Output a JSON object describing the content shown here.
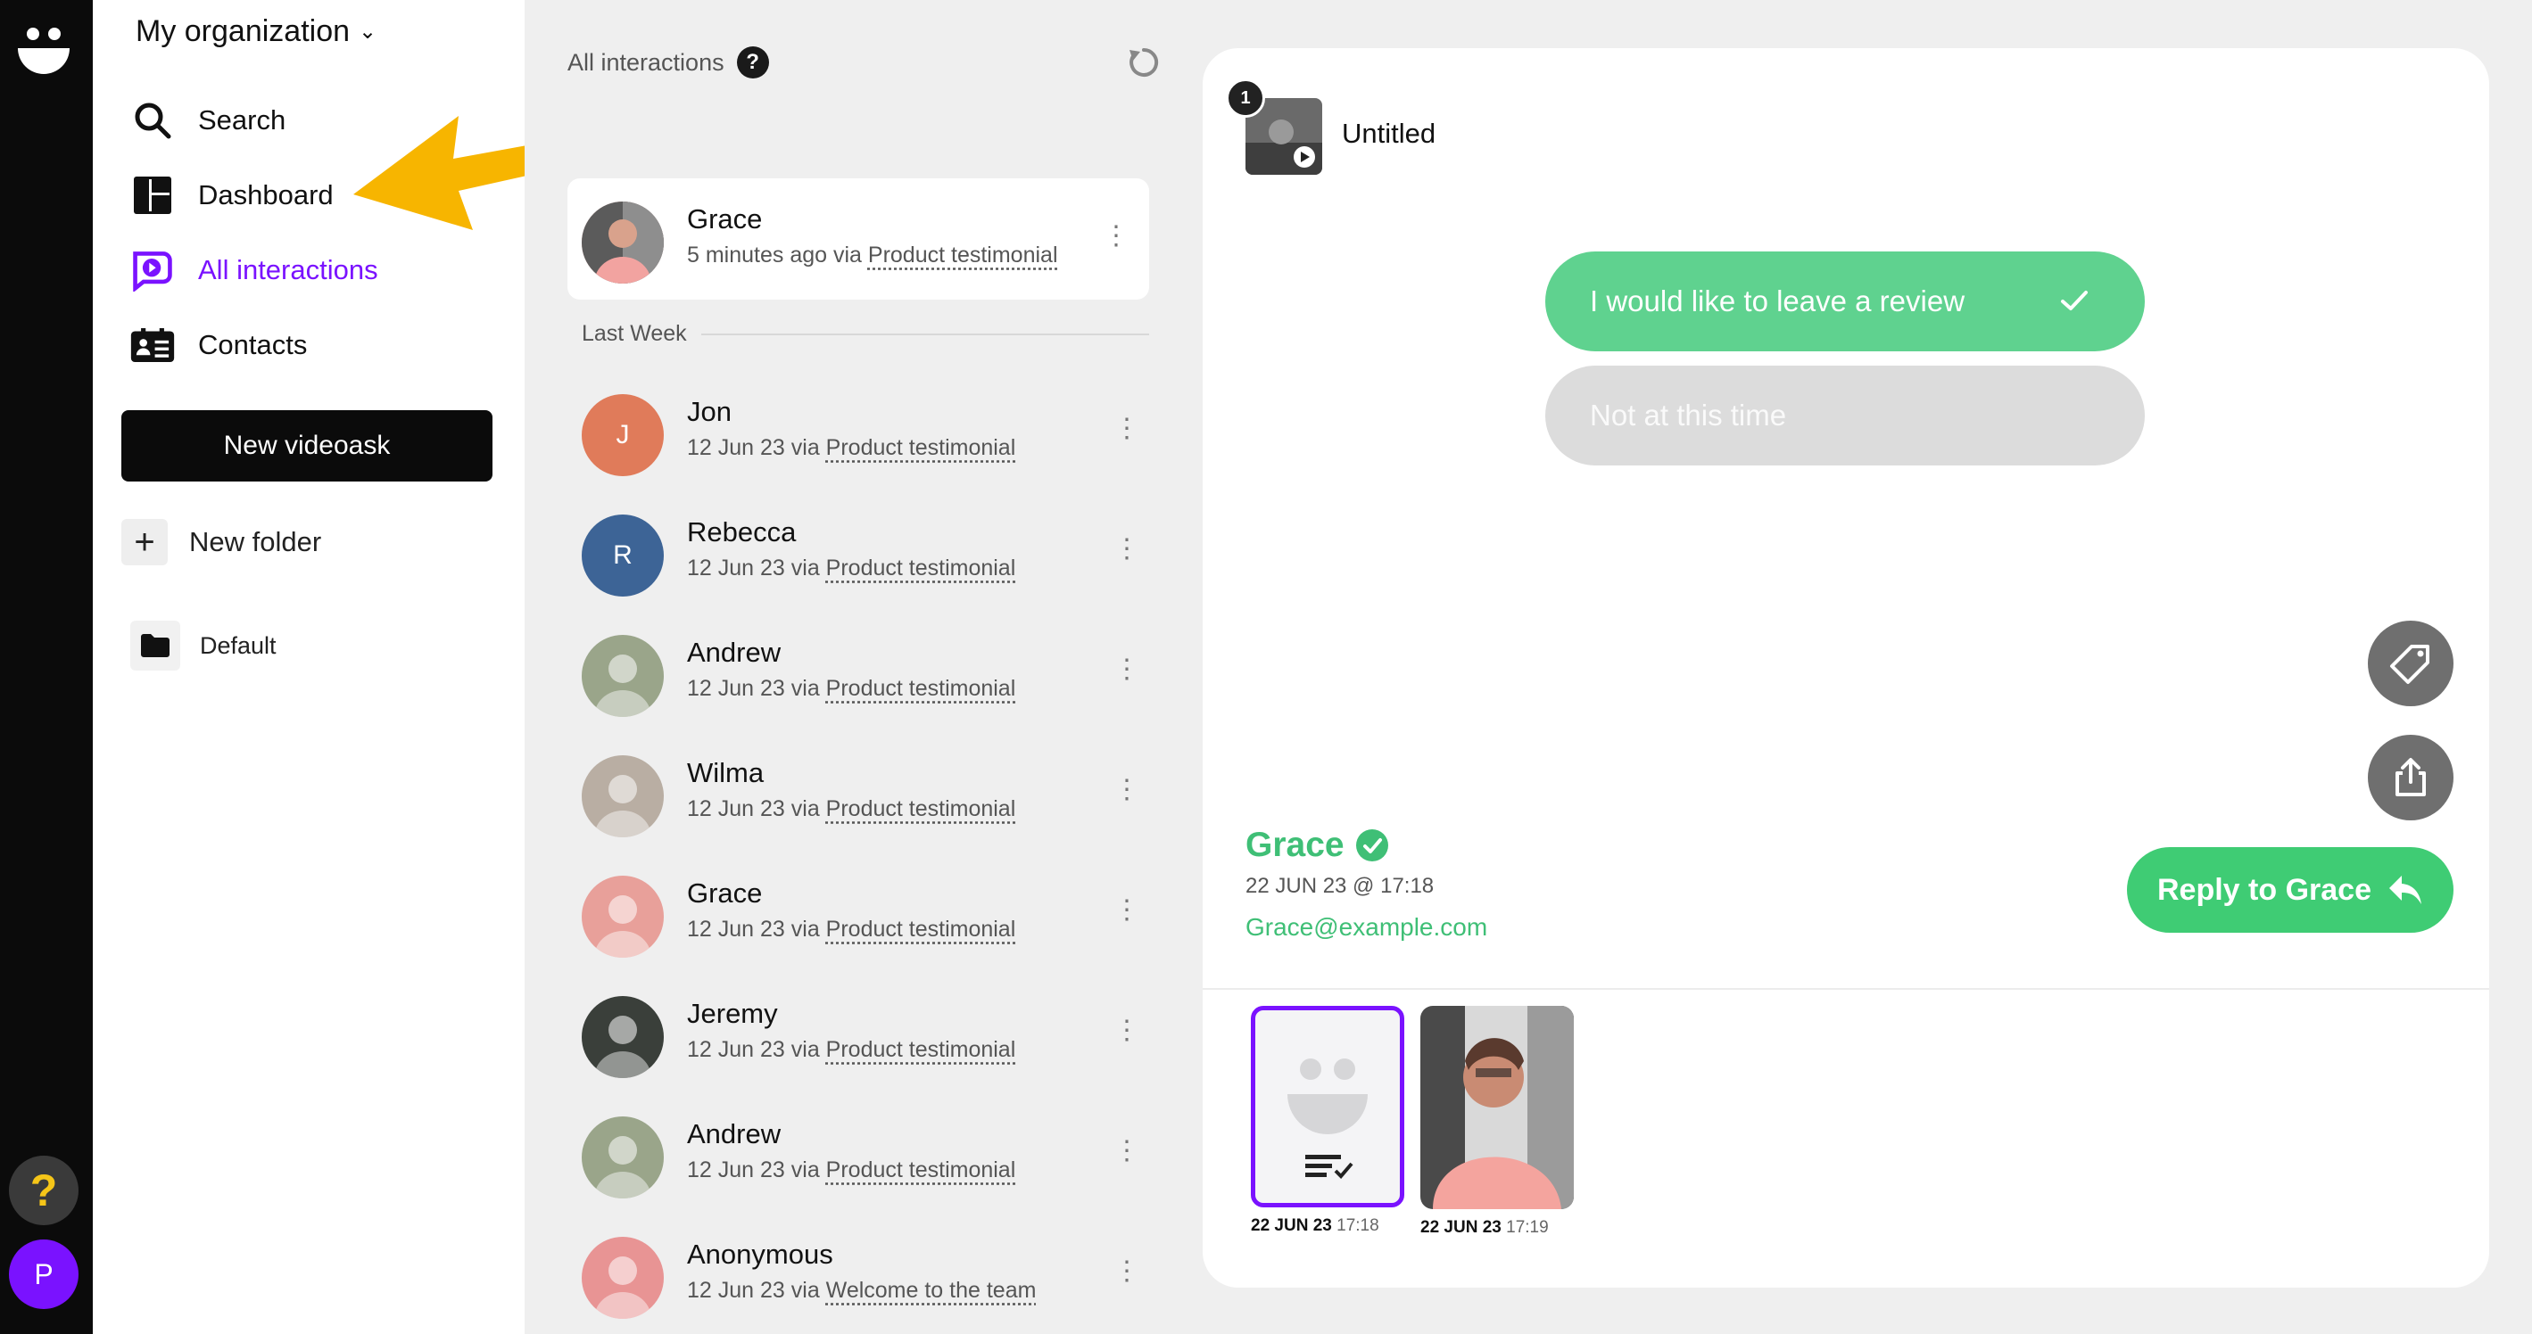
{
  "org": {
    "name": "My organization"
  },
  "nav": {
    "search": "Search",
    "dashboard": "Dashboard",
    "all_interactions": "All interactions",
    "contacts": "Contacts",
    "new_videoask": "New videoask",
    "new_folder": "New folder",
    "default_folder": "Default"
  },
  "rail": {
    "help": "?",
    "avatar": "P"
  },
  "list": {
    "header": "All interactions",
    "help": "?",
    "today": {
      "name": "Grace",
      "time": "5 minutes ago via",
      "source": "Product testimonial"
    },
    "section": "Last Week",
    "items": [
      {
        "name": "Jon",
        "date": "12 Jun 23 via",
        "source": "Product testimonial",
        "initial": "J",
        "color": "#e07b5a"
      },
      {
        "name": "Rebecca",
        "date": "12 Jun 23 via",
        "source": "Product testimonial",
        "initial": "R",
        "color": "#3d6496"
      },
      {
        "name": "Andrew",
        "date": "12 Jun 23 via",
        "source": "Product testimonial",
        "initial": "",
        "color": "#9aa58a"
      },
      {
        "name": "Wilma",
        "date": "12 Jun 23 via",
        "source": "Product testimonial",
        "initial": "",
        "color": "#b9aea3"
      },
      {
        "name": "Grace",
        "date": "12 Jun 23 via",
        "source": "Product testimonial",
        "initial": "",
        "color": "#e8a09a"
      },
      {
        "name": "Jeremy",
        "date": "12 Jun 23 via",
        "source": "Product testimonial",
        "initial": "",
        "color": "#3a3f3a"
      },
      {
        "name": "Andrew",
        "date": "12 Jun 23 via",
        "source": "Product testimonial",
        "initial": "",
        "color": "#9aa58a"
      },
      {
        "name": "Anonymous",
        "date": "12 Jun 23 via",
        "source": "Welcome to the team",
        "initial": "",
        "color": "#e89494"
      }
    ]
  },
  "detail": {
    "step_number": "1",
    "title": "Untitled",
    "choice_yes": "I would like to leave a review",
    "choice_no": "Not at this time",
    "contact_name": "Grace",
    "contact_date": "22 JUN 23 @ 17:18",
    "contact_email": "Grace@example.com",
    "reply_label": "Reply to Grace",
    "steps": [
      {
        "date": "22 JUN 23",
        "time": "17:18"
      },
      {
        "date": "22 JUN 23",
        "time": "17:19"
      }
    ]
  },
  "colors": {
    "accent": "#7a12ff",
    "green": "#3fcc74",
    "arrow": "#f7b500"
  }
}
